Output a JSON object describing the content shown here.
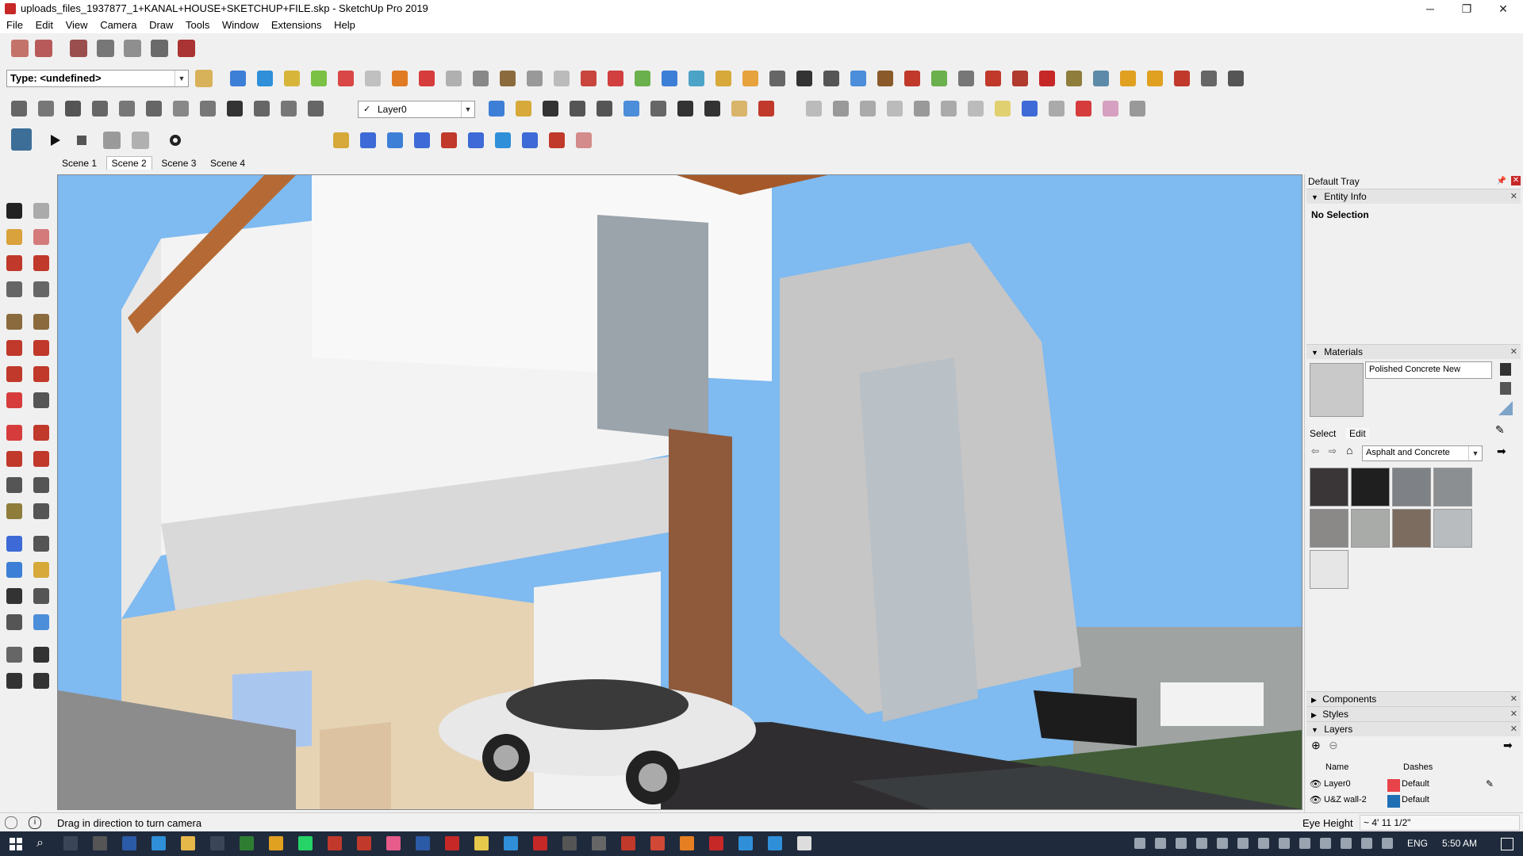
{
  "window": {
    "title": "uploads_files_1937877_1+KANAL+HOUSE+SKETCHUP+FILE.skp - SketchUp Pro 2019",
    "minimize": "─",
    "maximize": "❐",
    "close": "✕"
  },
  "menu": [
    "File",
    "Edit",
    "View",
    "Camera",
    "Draw",
    "Tools",
    "Window",
    "Extensions",
    "Help"
  ],
  "toolbar": {
    "type_combo": "Type: <undefined>",
    "layer_combo": "Layer0"
  },
  "scenes": {
    "tabs": [
      "Scene 1",
      "Scene 2",
      "Scene 3",
      "Scene 4"
    ],
    "active": "Scene 2"
  },
  "tray": {
    "title": "Default Tray",
    "entity_info": {
      "header": "Entity Info",
      "selection": "No Selection"
    },
    "materials": {
      "header": "Materials",
      "current": "Polished Concrete New",
      "tab_select": "Select",
      "tab_edit": "Edit",
      "library": "Asphalt and Concrete",
      "swatches": [
        "#3a3638",
        "#1f1f1f",
        "#7e8186",
        "#8c8f91",
        "#8a8988",
        "#a9aba8",
        "#7c6c60",
        "#b9bcbf",
        "#e6e6e6"
      ]
    },
    "components": "Components",
    "styles": "Styles",
    "layers": {
      "header": "Layers",
      "col_name": "Name",
      "col_dashes": "Dashes",
      "rows": [
        {
          "name": "Layer0",
          "color": "#e8434a",
          "dashes": "Default"
        },
        {
          "name": "U&Z wall-2",
          "color": "#1f6fb5",
          "dashes": "Default"
        }
      ]
    }
  },
  "status": {
    "message": "Drag in direction to turn camera",
    "measure_label": "Eye Height",
    "measure_value": "~ 4' 11 1/2\""
  },
  "taskbar": {
    "lang": "ENG",
    "time": "5:50 AM"
  }
}
